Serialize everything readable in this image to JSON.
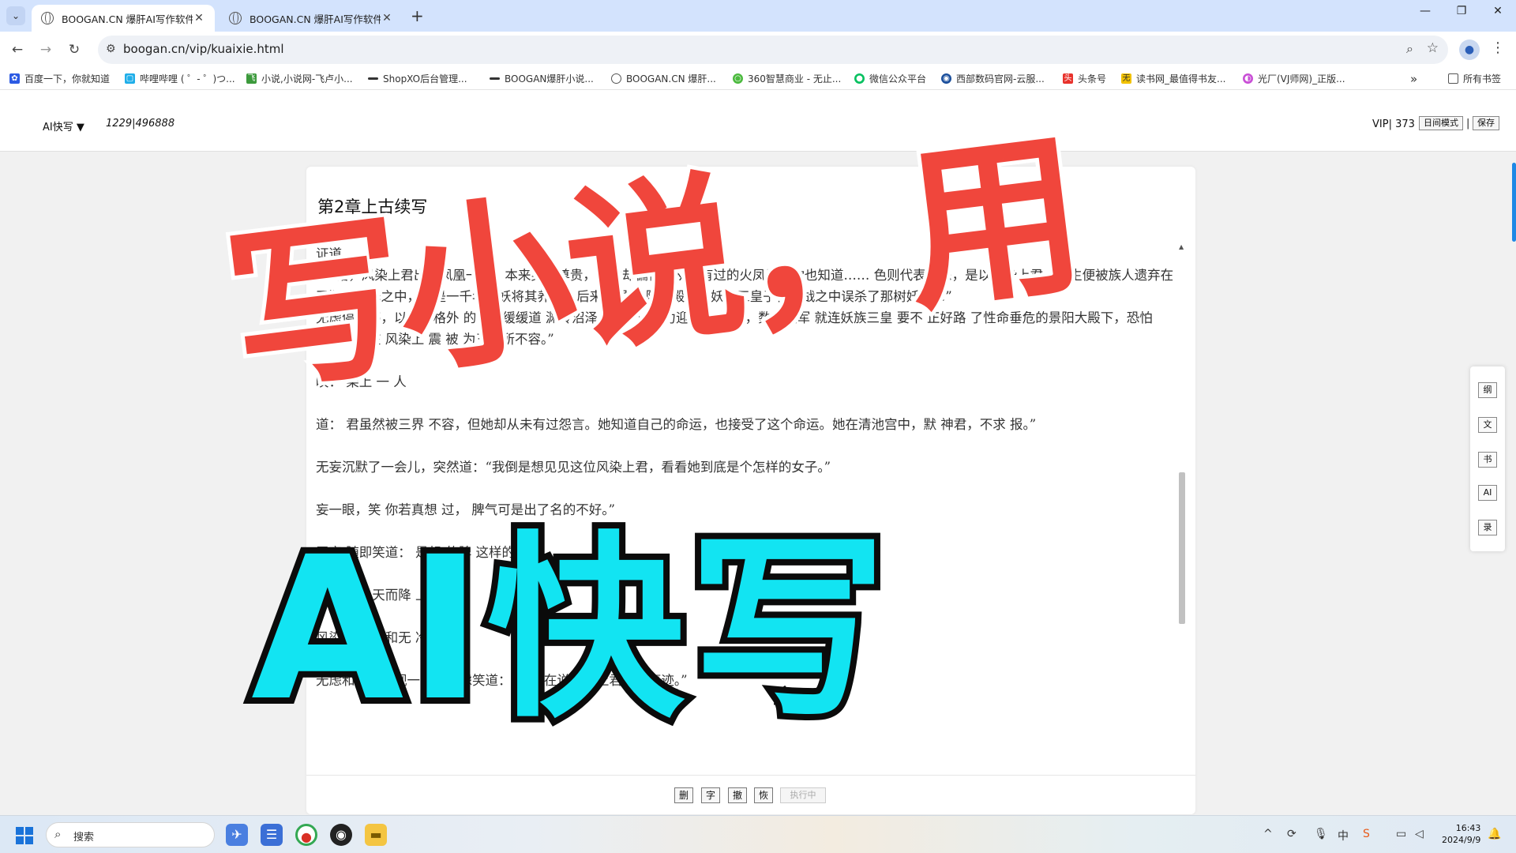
{
  "browser": {
    "tabs": [
      {
        "title": "BOOGAN.CN 爆肝AI写作软件",
        "active": true
      },
      {
        "title": "BOOGAN.CN 爆肝AI写作软件",
        "active": false
      }
    ],
    "new_tab": "+",
    "url": "boogan.cn/vip/kuaixie.html",
    "bookmarks": [
      "百度一下，你就知道",
      "哔哩哔哩 ( ゜- ゜)つ...",
      "小说,小说网-飞卢小...",
      "ShopXO后台管理...",
      "BOOGAN爆肝小说...",
      "BOOGAN.CN 爆肝...",
      "360智慧商业 - 无止...",
      "微信公众平台",
      "西部数码官网-云服...",
      "头条号",
      "读书网_最值得书友...",
      "光厂(VJ师网)_正版..."
    ],
    "more_bookmarks": "»",
    "all_bookmarks": "所有书签"
  },
  "app": {
    "mode_label": "AI快写 ▼",
    "word_count": "1229|496888",
    "vip_label": "VIP| 373",
    "day_mode_button": "日间模式",
    "separator": "|",
    "save_button": "保存"
  },
  "editor": {
    "chapter_title": "第2章上古续写",
    "paragraphs": [
      "证道。",
      "“不错，风染上君出自凤凰一族，本来身份尊贵，可她却偏偏是从未有过的火凤凰，你也知道……          色则代表邪恶，是以风染上君一出生便被族人遗弃在了渊岭沼泽之中，乃是一千年树妖将其养大，后来仙界和            阳大殿下和妖界三皇子在混战之中误杀了那树妖……”",
      "无虑停了停，以一种格外     的语气缓缓道        渊岭沼泽，以一己之力迎战仙       惨烈，数万大军              就连妖族三皇         要不            正好路       了性命垂危的景阳大殿下，恐怕                了。也是在       风染上           震        被             为三界所不容。”",
      "                 叹：        染上      一          人",
      "                 道：       君虽然被三界     不容，但她却从未有过怨言。她知道自己的命运，也接受了这个命运。她在清池宫中，默              神君，不求    报。”",
      "无妄沉默了一会儿，突然道：“我倒是想见见这位风染上君，看看她到底是个怎样的女子。”",
      "              妄一眼，笑      你若真想            过，                     脾气可是出了名的不好。”",
      "无妄          随即笑道：         是想         的脾         这样的",
      "               突然，         从天而降                      上",
      "风染上君        妄和无        冷道：",
      "无虑和无妄对视一眼，无虑笑道：“我们在说风染上君你的事迹。”"
    ],
    "format_buttons": [
      "删",
      "字",
      "撤",
      "恢"
    ],
    "exec_button": "执行中"
  },
  "sidebar": {
    "buttons": [
      "纲",
      "文",
      "书",
      "AI",
      "录"
    ]
  },
  "overlay": {
    "top_text": "写小说，用",
    "bottom_text": "AI快写",
    "top_color": "#f0463c",
    "bottom_color": "#12e4f2"
  },
  "taskbar": {
    "search_label": "搜索",
    "time": "16:43",
    "date": "2024/9/9"
  }
}
